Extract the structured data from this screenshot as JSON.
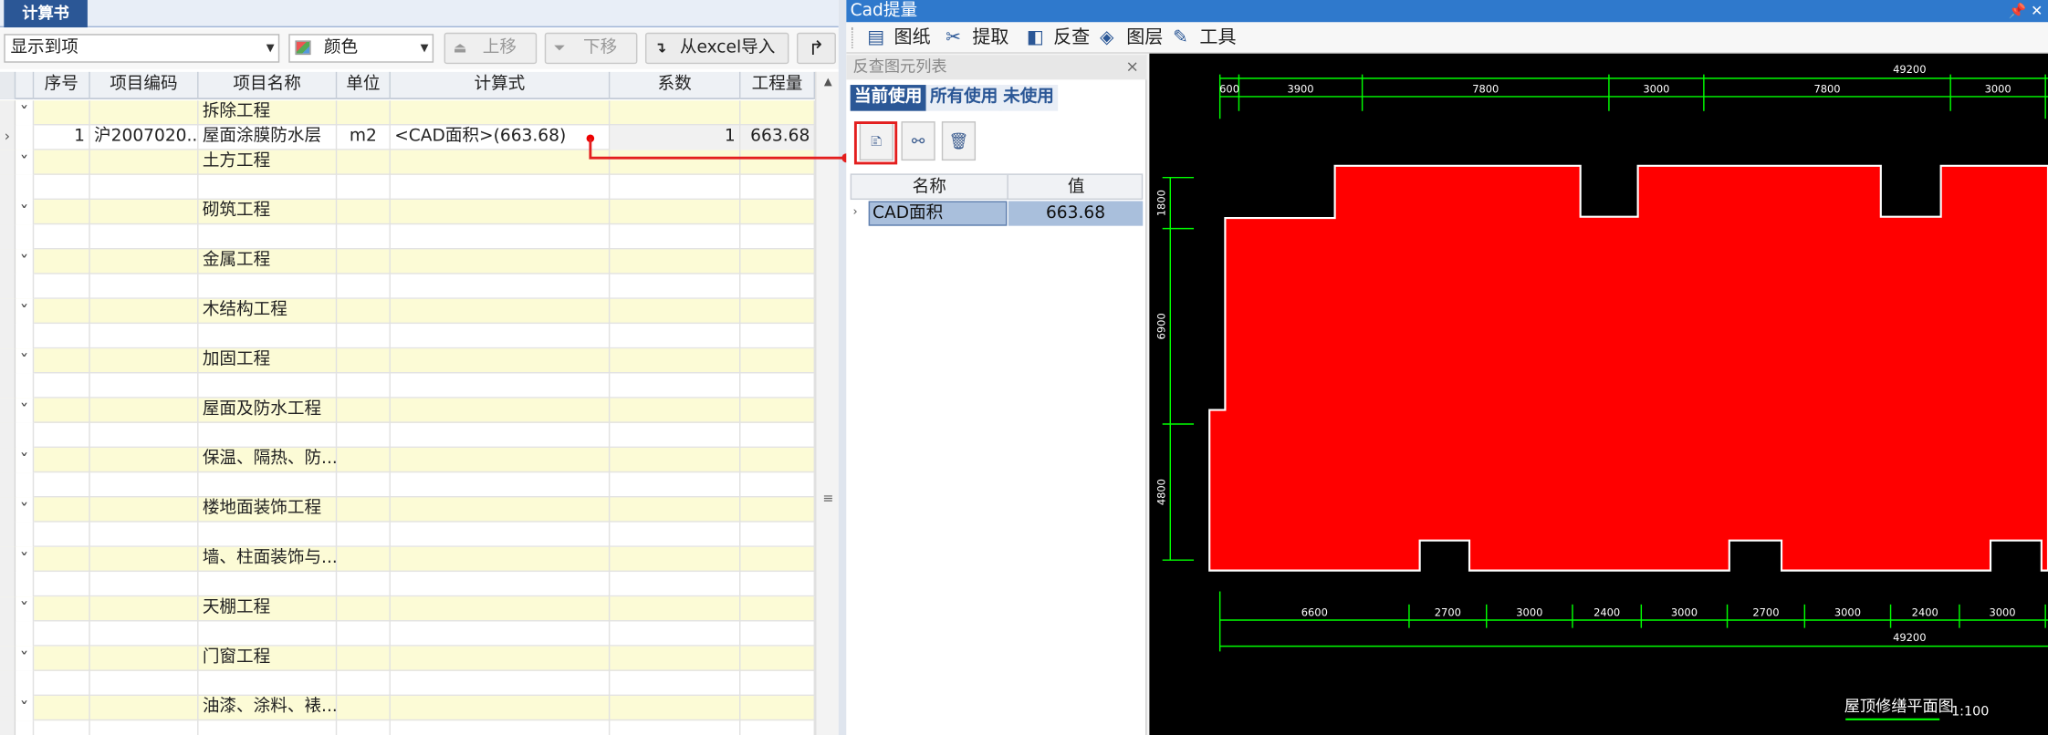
{
  "left_panel": {
    "tab_label": "计算书",
    "toolbar": {
      "display_select": "显示到项",
      "color_select": "颜色",
      "move_up": "上移",
      "move_down": "下移",
      "import_excel": "从excel导入"
    },
    "columns": [
      "序号",
      "项目编码",
      "项目名称",
      "单位",
      "计算式",
      "系数",
      "工程量"
    ],
    "data_row": {
      "index": "1",
      "code": "沪2007020...",
      "name": "屋面涂膜防水层",
      "unit": "m2",
      "formula": "<CAD面积>(663.68)",
      "coef": "1",
      "quantity": "663.68"
    },
    "categories": [
      "拆除工程",
      "土方工程",
      "砌筑工程",
      "金属工程",
      "木结构工程",
      "加固工程",
      "屋面及防水工程",
      "保温、隔热、防...",
      "楼地面装饰工程",
      "墙、柱面装饰与...",
      "天棚工程",
      "门窗工程",
      "油漆、涂料、裱..."
    ]
  },
  "cad_window": {
    "title": "Cad提量",
    "title_controls": "📌 ✕",
    "tools": [
      {
        "icon": "drawing-icon",
        "label": "图纸"
      },
      {
        "icon": "extract-icon",
        "label": "提取"
      },
      {
        "icon": "reverse-check-icon",
        "label": "反查"
      },
      {
        "icon": "layers-icon",
        "label": "图层"
      },
      {
        "icon": "tools-icon",
        "label": "工具"
      }
    ],
    "reverse_panel": {
      "title": "反查图元列表",
      "close": "×",
      "tabs": [
        "当前使用",
        "所有使用",
        "未使用"
      ],
      "columns": [
        "名称",
        "值"
      ],
      "row": {
        "name": "CAD面积",
        "value": "663.68"
      }
    },
    "drawing": {
      "top_dims": [
        "600",
        "3900",
        "7800",
        "3000",
        "7800",
        "3000"
      ],
      "top_total": "49200",
      "bottom_dims": [
        "6600",
        "2700",
        "3000",
        "2400",
        "3000",
        "2700",
        "3000",
        "2400",
        "3000"
      ],
      "bottom_total": "49200",
      "left_dims": [
        "1800",
        "6900",
        "4800"
      ],
      "title": "屋顶修缮平面图",
      "scale": "1:100",
      "fill_color": "#ff0000",
      "dim_color": "#00ff00"
    }
  }
}
